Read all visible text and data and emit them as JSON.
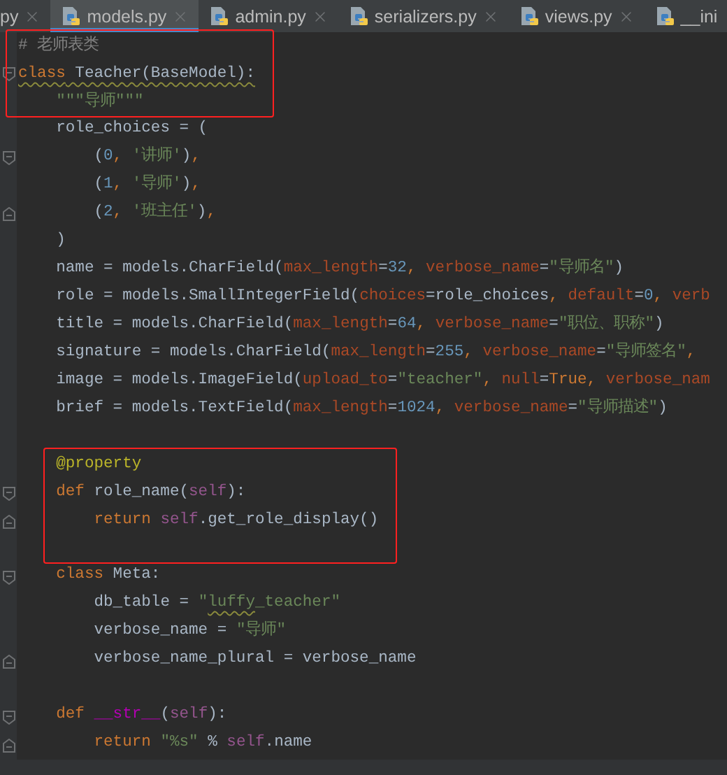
{
  "tabs": [
    {
      "label": "py",
      "selected": false,
      "closable": true
    },
    {
      "label": "models.py",
      "selected": true,
      "closable": true
    },
    {
      "label": "admin.py",
      "selected": false,
      "closable": true
    },
    {
      "label": "serializers.py",
      "selected": false,
      "closable": true
    },
    {
      "label": "views.py",
      "selected": false,
      "closable": true
    },
    {
      "label": "__ini",
      "selected": false,
      "closable": false
    }
  ],
  "blocks": [
    {
      "boxed": true,
      "lines": [
        {
          "kind": "code",
          "tokens": [
            {
              "kind": "comment",
              "t": "# 老师表类"
            }
          ]
        },
        {
          "kind": "code",
          "fold_start": true,
          "tokens": [
            {
              "kind": "keyword",
              "t": "class",
              "warn": true
            },
            {
              "kind": "plain",
              "t": " Teacher(BaseModel):",
              "warn": true
            }
          ]
        },
        {
          "kind": "code",
          "tokens": [
            {
              "kind": "string",
              "t": "    \"\"\"导师\"\"\""
            }
          ]
        }
      ]
    },
    {
      "boxed": false,
      "lines": [
        {
          "kind": "code",
          "tokens": [
            {
              "kind": "plain",
              "t": "    role_choices = ("
            }
          ]
        },
        {
          "kind": "code",
          "fold_start": true,
          "tokens": [
            {
              "kind": "plain",
              "t": "        ("
            },
            {
              "kind": "number",
              "t": "0"
            },
            {
              "kind": "keyword",
              "t": ", "
            },
            {
              "kind": "string",
              "t": "'讲师'"
            },
            {
              "kind": "plain",
              "t": ")"
            },
            {
              "kind": "keyword",
              "t": ","
            }
          ]
        },
        {
          "kind": "code",
          "tokens": [
            {
              "kind": "plain",
              "t": "        ("
            },
            {
              "kind": "number",
              "t": "1"
            },
            {
              "kind": "keyword",
              "t": ", "
            },
            {
              "kind": "string",
              "t": "'导师'"
            },
            {
              "kind": "plain",
              "t": ")"
            },
            {
              "kind": "keyword",
              "t": ","
            }
          ]
        },
        {
          "kind": "code",
          "fold_end": true,
          "tokens": [
            {
              "kind": "plain",
              "t": "        ("
            },
            {
              "kind": "number",
              "t": "2"
            },
            {
              "kind": "keyword",
              "t": ", "
            },
            {
              "kind": "string",
              "t": "'班主任'"
            },
            {
              "kind": "plain",
              "t": ")"
            },
            {
              "kind": "keyword",
              "t": ","
            }
          ]
        },
        {
          "kind": "code",
          "tokens": [
            {
              "kind": "plain",
              "t": "    )"
            }
          ]
        },
        {
          "kind": "code",
          "tokens": [
            {
              "kind": "plain",
              "t": "    name = models.CharField("
            },
            {
              "kind": "argument",
              "t": "max_length"
            },
            {
              "kind": "plain",
              "t": "="
            },
            {
              "kind": "number",
              "t": "32"
            },
            {
              "kind": "keyword",
              "t": ", "
            },
            {
              "kind": "argument",
              "t": "verbose_name"
            },
            {
              "kind": "plain",
              "t": "="
            },
            {
              "kind": "string",
              "t": "\"导师名\""
            },
            {
              "kind": "plain",
              "t": ")"
            }
          ]
        },
        {
          "kind": "code",
          "tokens": [
            {
              "kind": "plain",
              "t": "    role = models.SmallIntegerField("
            },
            {
              "kind": "argument",
              "t": "choices"
            },
            {
              "kind": "plain",
              "t": "=role_choices"
            },
            {
              "kind": "keyword",
              "t": ", "
            },
            {
              "kind": "argument",
              "t": "default"
            },
            {
              "kind": "plain",
              "t": "="
            },
            {
              "kind": "number",
              "t": "0"
            },
            {
              "kind": "keyword",
              "t": ", "
            },
            {
              "kind": "argument",
              "t": "verb"
            }
          ]
        },
        {
          "kind": "code",
          "tokens": [
            {
              "kind": "plain",
              "t": "    title = models.CharField("
            },
            {
              "kind": "argument",
              "t": "max_length"
            },
            {
              "kind": "plain",
              "t": "="
            },
            {
              "kind": "number",
              "t": "64"
            },
            {
              "kind": "keyword",
              "t": ", "
            },
            {
              "kind": "argument",
              "t": "verbose_name"
            },
            {
              "kind": "plain",
              "t": "="
            },
            {
              "kind": "string",
              "t": "\"职位、职称\""
            },
            {
              "kind": "plain",
              "t": ")"
            }
          ]
        },
        {
          "kind": "code",
          "tokens": [
            {
              "kind": "plain",
              "t": "    signature = models.CharField("
            },
            {
              "kind": "argument",
              "t": "max_length"
            },
            {
              "kind": "plain",
              "t": "="
            },
            {
              "kind": "number",
              "t": "255"
            },
            {
              "kind": "keyword",
              "t": ", "
            },
            {
              "kind": "argument",
              "t": "verbose_name"
            },
            {
              "kind": "plain",
              "t": "="
            },
            {
              "kind": "string",
              "t": "\"导师签名\""
            },
            {
              "kind": "keyword",
              "t": ","
            }
          ]
        },
        {
          "kind": "code",
          "tokens": [
            {
              "kind": "plain",
              "t": "    image = models.ImageField("
            },
            {
              "kind": "argument",
              "t": "upload_to"
            },
            {
              "kind": "plain",
              "t": "="
            },
            {
              "kind": "string",
              "t": "\"teacher\""
            },
            {
              "kind": "keyword",
              "t": ", "
            },
            {
              "kind": "argument",
              "t": "null"
            },
            {
              "kind": "plain",
              "t": "="
            },
            {
              "kind": "keyword",
              "t": "True, "
            },
            {
              "kind": "argument",
              "t": "verbose_nam"
            }
          ]
        },
        {
          "kind": "code",
          "tokens": [
            {
              "kind": "plain",
              "t": "    brief = models.TextField("
            },
            {
              "kind": "argument",
              "t": "max_length"
            },
            {
              "kind": "plain",
              "t": "="
            },
            {
              "kind": "number",
              "t": "1024"
            },
            {
              "kind": "keyword",
              "t": ", "
            },
            {
              "kind": "argument",
              "t": "verbose_name"
            },
            {
              "kind": "plain",
              "t": "="
            },
            {
              "kind": "string",
              "t": "\"导师描述\""
            },
            {
              "kind": "plain",
              "t": ")"
            }
          ]
        },
        {
          "kind": "blank"
        }
      ]
    },
    {
      "boxed": true,
      "lines": [
        {
          "kind": "code",
          "tokens": [
            {
              "kind": "decorator",
              "t": "    @property"
            }
          ]
        },
        {
          "kind": "code",
          "fold_start": true,
          "tokens": [
            {
              "kind": "keyword",
              "t": "    def"
            },
            {
              "kind": "plain",
              "t": " role_name("
            },
            {
              "kind": "self",
              "t": "self"
            },
            {
              "kind": "plain",
              "t": "):"
            }
          ]
        },
        {
          "kind": "code",
          "fold_end": true,
          "tokens": [
            {
              "kind": "keyword",
              "t": "        return "
            },
            {
              "kind": "self",
              "t": "self"
            },
            {
              "kind": "plain",
              "t": ".get_role_display()"
            }
          ]
        },
        {
          "kind": "blank"
        }
      ]
    },
    {
      "boxed": false,
      "lines": [
        {
          "kind": "code",
          "fold_start": true,
          "tokens": [
            {
              "kind": "keyword",
              "t": "    class"
            },
            {
              "kind": "plain",
              "t": " Meta:"
            }
          ]
        },
        {
          "kind": "code",
          "tokens": [
            {
              "kind": "plain",
              "t": "        db_table = "
            },
            {
              "kind": "string",
              "t": "\""
            },
            {
              "kind": "string",
              "t": "luffy",
              "warn": true
            },
            {
              "kind": "string",
              "t": "_teacher\""
            }
          ]
        },
        {
          "kind": "code",
          "tokens": [
            {
              "kind": "plain",
              "t": "        verbose_name = "
            },
            {
              "kind": "string",
              "t": "\"导师\""
            }
          ]
        },
        {
          "kind": "code",
          "fold_end": true,
          "tokens": [
            {
              "kind": "plain",
              "t": "        verbose_name_plural = verbose_name"
            }
          ]
        },
        {
          "kind": "blank"
        },
        {
          "kind": "code",
          "fold_start": true,
          "tokens": [
            {
              "kind": "keyword",
              "t": "    def"
            },
            {
              "kind": "magic",
              "t": " __str__"
            },
            {
              "kind": "plain",
              "t": "("
            },
            {
              "kind": "self",
              "t": "self"
            },
            {
              "kind": "plain",
              "t": "):"
            }
          ]
        },
        {
          "kind": "code",
          "fold_end": true,
          "tokens": [
            {
              "kind": "keyword",
              "t": "        return "
            },
            {
              "kind": "string",
              "t": "\"%s\""
            },
            {
              "kind": "plain",
              "t": " % "
            },
            {
              "kind": "self",
              "t": "self"
            },
            {
              "kind": "plain",
              "t": ".name"
            }
          ]
        }
      ]
    }
  ]
}
